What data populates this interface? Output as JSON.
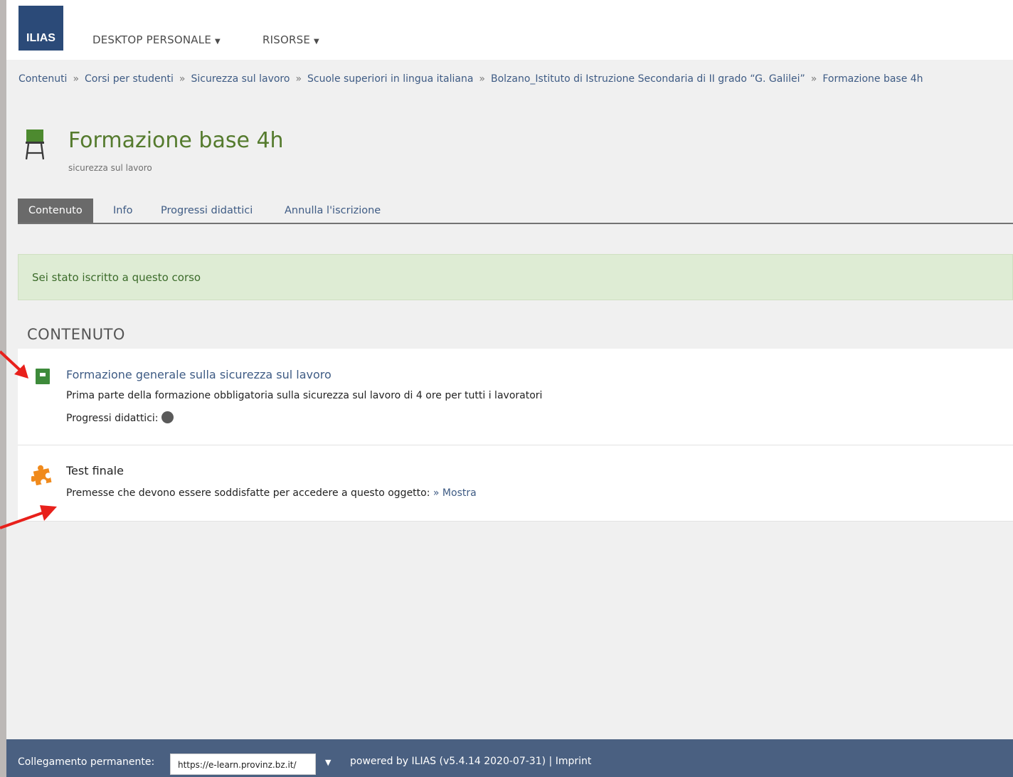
{
  "header": {
    "logo_text": "ILIAS",
    "nav": [
      {
        "label": "DESKTOP PERSONALE"
      },
      {
        "label": "RISORSE"
      }
    ]
  },
  "breadcrumb": [
    {
      "label": "Contenuti"
    },
    {
      "label": "Corsi per studenti"
    },
    {
      "label": "Sicurezza sul lavoro"
    },
    {
      "label": "Scuole superiori in lingua italiana"
    },
    {
      "label": "Bolzano_Istituto di Istruzione Secondaria di II grado “G. Galilei”"
    },
    {
      "label": "Formazione base 4h"
    }
  ],
  "breadcrumb_separator": "»",
  "page": {
    "title": "Formazione base 4h",
    "description": "sicurezza sul lavoro"
  },
  "tabs": [
    {
      "label": "Contenuto",
      "active": true
    },
    {
      "label": "Info"
    },
    {
      "label": "Progressi didattici"
    },
    {
      "label": "Annulla l'iscrizione"
    }
  ],
  "notice": "Sei stato iscritto a questo corso",
  "content": {
    "section_title": "CONTENUTO",
    "items": [
      {
        "title": "Formazione generale sulla sicurezza sul lavoro",
        "description": "Prima parte della formazione obbligatoria sulla sicurezza sul lavoro di 4 ore per tutti i lavoratori",
        "progress_label": "Progressi didattici:",
        "icon": "learning-module-icon"
      },
      {
        "title": "Test finale",
        "prereq_label": "Premesse che devono essere soddisfatte per accedere a questo oggetto:",
        "prereq_link": "» Mostra",
        "icon": "test-puzzle-icon"
      }
    ]
  },
  "footer": {
    "permalink_label": "Collegamento permanente:",
    "permalink_value": "https://e-learn.provinz.bz.it/",
    "powered": "powered by ILIAS (v5.4.14 2020-07-31) |",
    "imprint": "Imprint"
  },
  "colors": {
    "brand": "#2b4a78",
    "title_green": "#557b2e",
    "link": "#3e5b84",
    "notice_bg": "#deecd4",
    "footer_bg": "#4a6081",
    "annotation_arrow": "#e8201b"
  }
}
